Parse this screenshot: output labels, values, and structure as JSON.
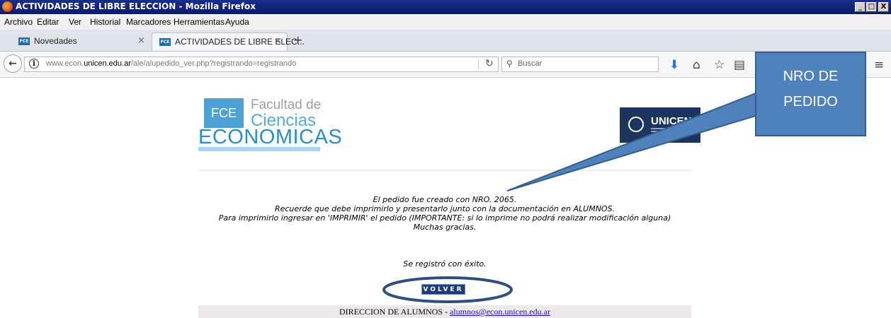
{
  "window": {
    "title": "ACTIVIDADES DE LIBRE ELECCION - Mozilla Firefox",
    "controls": [
      "_",
      "□",
      "X"
    ]
  },
  "menubar": [
    "Archivo",
    "Editar",
    "Ver",
    "Historial",
    "Marcadores",
    "Herramientas",
    "Ayuda"
  ],
  "tabs": [
    {
      "label": "Novedades",
      "favicon": "FCE",
      "active": false
    },
    {
      "label": "ACTIVIDADES DE LIBRE ELEC...",
      "favicon": "FCE",
      "active": true
    }
  ],
  "new_tab": "+",
  "navbar": {
    "url_prefix": "www.econ.",
    "url_domain": "unicen.edu.ar",
    "url_path": "/ale/alupedido_ver.php?registrando=registrando",
    "search_placeholder": "Buscar"
  },
  "page": {
    "logo": {
      "box": "FCE",
      "line1": "Facultad de",
      "line2": "Ciencias",
      "line3": "ECONOMICAS"
    },
    "unicen_logo": "UNICEN",
    "message_lines": [
      "El pedido fue creado con NRO.  2065.",
      "Recuerde que debe imprimirlo y presentarlo junto con la documentación en ALUMNOS.",
      "Para imprimirlo ingresar en 'IMPRIMIR' el pedido (IMPORTANTE: si lo imprime no podrá realizar modificación alguna)",
      "Muchas gracias."
    ],
    "success": "Se registró con éxito.",
    "volver_label": "VOLVER",
    "footer_text": "DIRECCION DE ALUMNOS - ",
    "footer_email": "alumnos@econ.unicen.edu.ar"
  },
  "annotation": {
    "line1": "NRO DE",
    "line2": "PEDIDO"
  },
  "colors": {
    "callout": "#4f81bd",
    "ellipse": "#2f4f7f",
    "titlebar": "#0a1a6e"
  }
}
